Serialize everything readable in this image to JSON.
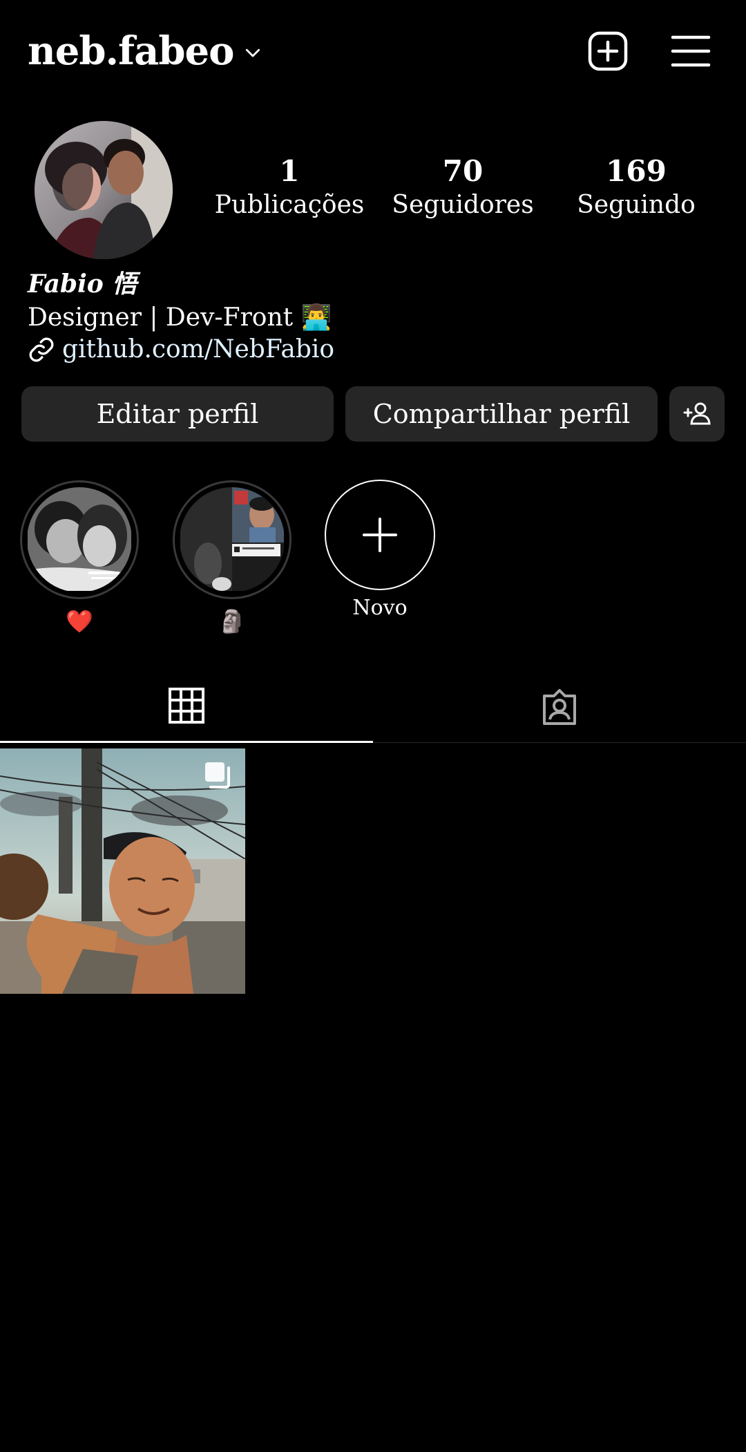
{
  "header": {
    "username": "neb.fabeo",
    "icons": [
      "chevron-down-icon",
      "create-post-icon",
      "menu-icon"
    ]
  },
  "profile": {
    "stats": [
      {
        "value": "1",
        "label": "Publicações"
      },
      {
        "value": "70",
        "label": "Seguidores"
      },
      {
        "value": "169",
        "label": "Seguindo"
      }
    ],
    "display_name": "Fabio 悟",
    "bio": "Designer | Dev-Front 👨‍💻",
    "link": "github.com/NebFabio"
  },
  "actions": {
    "edit": "Editar perfil",
    "share": "Compartilhar perfil",
    "add_icon": "person-add-icon"
  },
  "highlights": [
    {
      "label": "❤️"
    },
    {
      "label": "🗿"
    },
    {
      "label": "Novo"
    }
  ],
  "tabs": [
    {
      "icon": "grid-icon",
      "active": true
    },
    {
      "icon": "tagged-icon",
      "active": false
    }
  ],
  "posts": [
    {
      "multi": true
    }
  ],
  "colors": {
    "background": "#000000",
    "button": "#262626",
    "text": "#ffffff",
    "link": "#e0f1ff"
  }
}
